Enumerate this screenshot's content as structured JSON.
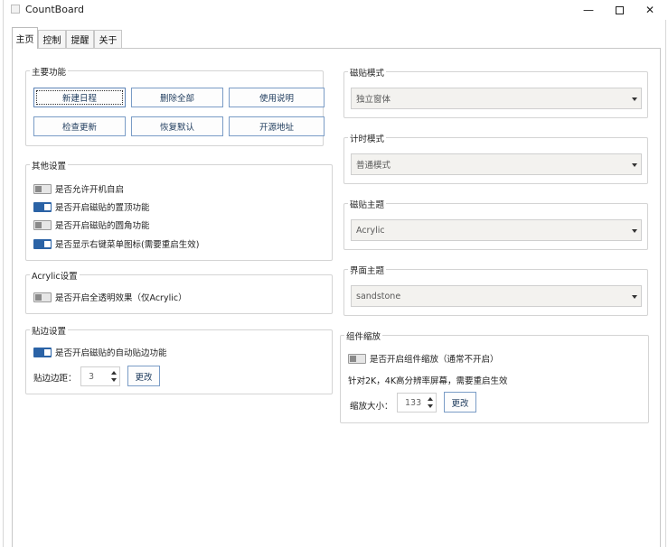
{
  "window": {
    "title": "CountBoard",
    "minimize_glyph": "—",
    "close_glyph": "✕"
  },
  "tabs": [
    {
      "label": "主页",
      "active": true
    },
    {
      "label": "控制",
      "active": false
    },
    {
      "label": "提醒",
      "active": false
    },
    {
      "label": "关于",
      "active": false
    }
  ],
  "main_functions": {
    "title": "主要功能",
    "buttons": [
      "新建日程",
      "删除全部",
      "使用说明",
      "检查更新",
      "恢复默认",
      "开源地址"
    ]
  },
  "other_settings": {
    "title": "其他设置",
    "options": [
      {
        "label": "是否允许开机自启",
        "on": false
      },
      {
        "label": "是否开启磁贴的置顶功能",
        "on": true
      },
      {
        "label": "是否开启磁贴的圆角功能",
        "on": false
      },
      {
        "label": "是否显示右键菜单图标(需要重启生效)",
        "on": true
      }
    ]
  },
  "acrylic_settings": {
    "title": "Acrylic设置",
    "option": {
      "label": "是否开启全透明效果（仅Acrylic）",
      "on": false
    }
  },
  "edge_settings": {
    "title": "贴边设置",
    "option": {
      "label": "是否开启磁贴的自动贴边功能",
      "on": true
    },
    "margin_label": "贴边边距：",
    "margin_value": "3",
    "change_label": "更改"
  },
  "tile_mode": {
    "title": "磁贴模式",
    "value": "独立窗体"
  },
  "timer_mode": {
    "title": "计时模式",
    "value": "普通模式"
  },
  "tile_theme": {
    "title": "磁贴主题",
    "value": "Acrylic"
  },
  "ui_theme": {
    "title": "界面主题",
    "value": "sandstone"
  },
  "component_scale": {
    "title": "组件缩放",
    "option": {
      "label": "是否开启组件缩放（通常不开启）",
      "on": false
    },
    "note": "针对2K，4K高分辨率屏幕，需要重启生效",
    "scale_label": "缩放大小：",
    "scale_value": "133",
    "change_label": "更改"
  },
  "colors": {
    "accent": "#2b63a6",
    "button_border": "#7a9cc6",
    "combo_bg": "#f3f2ef"
  }
}
